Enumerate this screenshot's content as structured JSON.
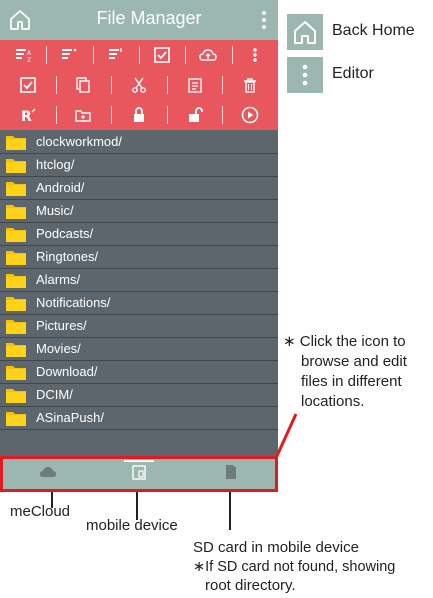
{
  "app": {
    "title": "File Manager"
  },
  "toolbar": {
    "row1": [
      "sort-az-icon",
      "sort-size-icon",
      "sort-date-icon",
      "select-check-icon",
      "cloud-upload-icon",
      "more-vert-icon"
    ],
    "row2": [
      "checkbox-icon",
      "copy-icon",
      "cut-icon",
      "paste-icon",
      "delete-icon"
    ],
    "row3": [
      "rename-icon",
      "new-folder-icon",
      "lock-icon",
      "unlock-icon",
      "play-icon"
    ]
  },
  "folders": [
    "clockworkmod/",
    "htclog/",
    "Android/",
    "Music/",
    "Podcasts/",
    "Ringtones/",
    "Alarms/",
    "Notifications/",
    "Pictures/",
    "Movies/",
    "Download/",
    "DCIM/",
    "ASinaPush/"
  ],
  "legend": {
    "back_home": "Back Home",
    "editor": "Editor"
  },
  "callout": {
    "click_icon_1": "∗ Click the icon to",
    "click_icon_2": "browse and edit",
    "click_icon_3": "files in different",
    "click_icon_4": "locations."
  },
  "labels": {
    "mecloud": "meCloud",
    "mobile_device": "mobile device",
    "sd_card": "SD card in mobile device",
    "sd_note_1": "∗If SD card not found, showing",
    "sd_note_2": "root directory."
  },
  "colors": {
    "titlebar": "#9cb7b0",
    "toolbar": "#e7575d",
    "list_bg": "#5d666d",
    "folder": "#f6c100",
    "highlight": "#e11b22"
  }
}
